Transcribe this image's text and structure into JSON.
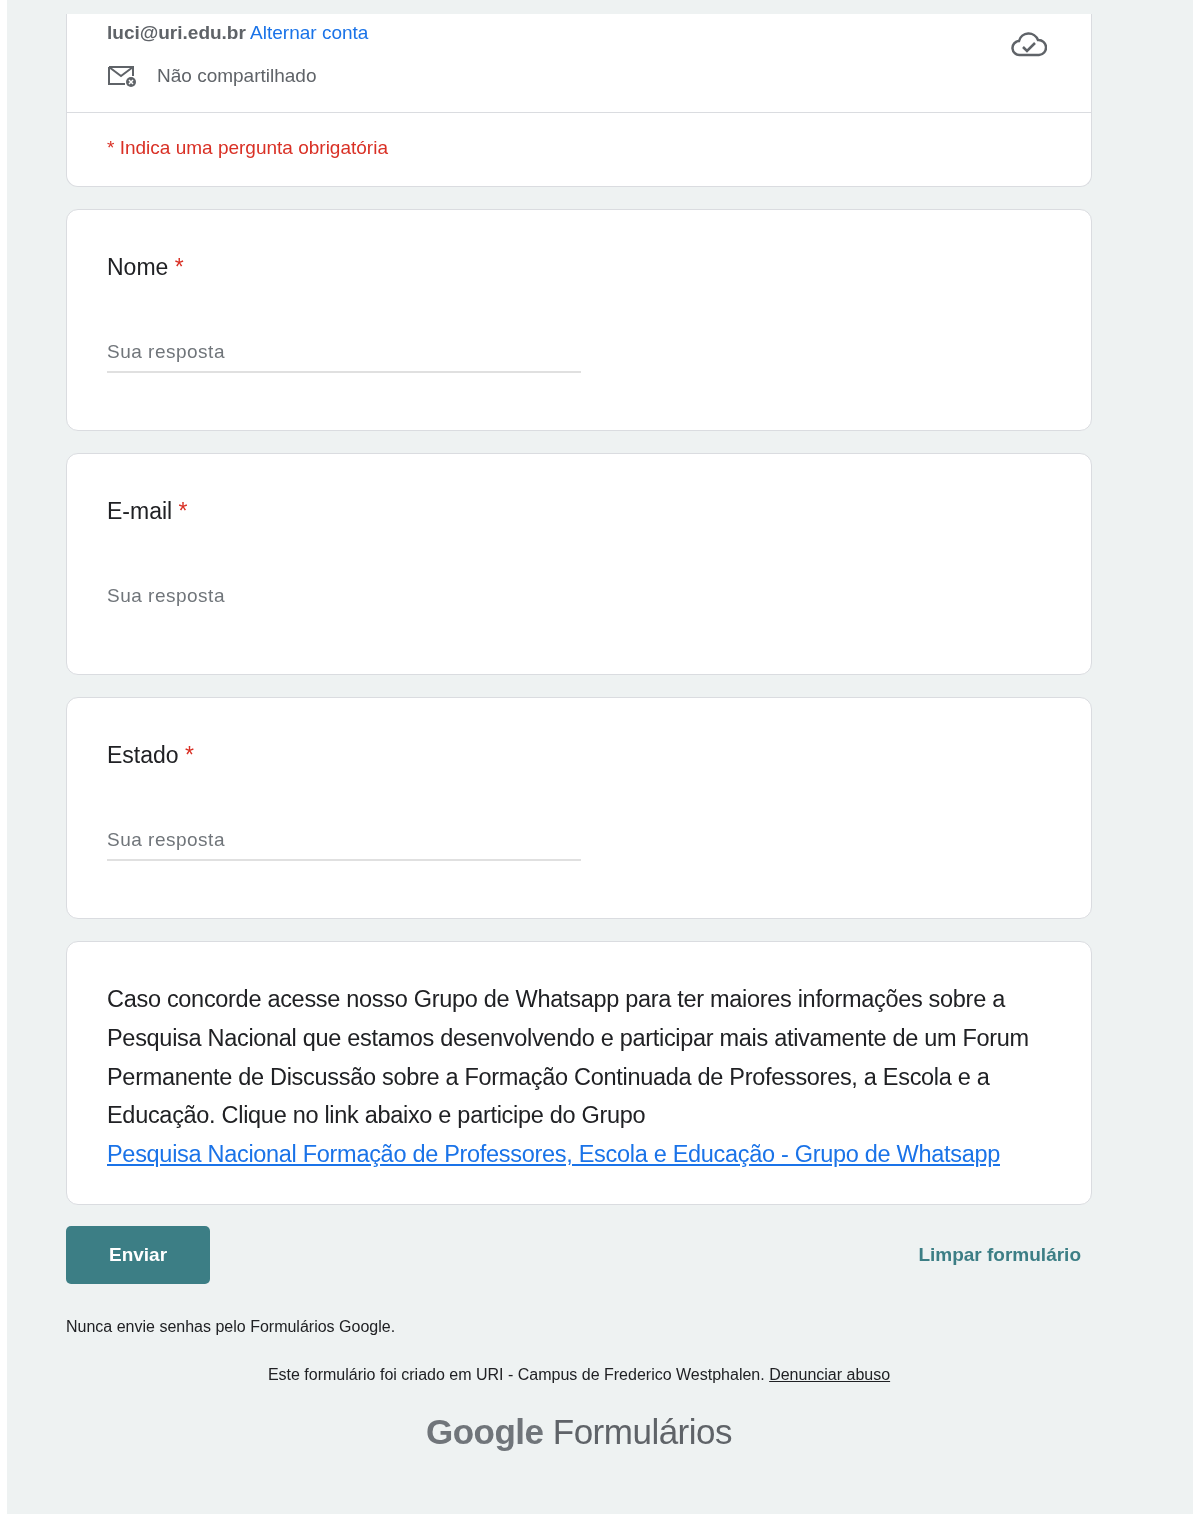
{
  "account": {
    "email": "luci@uri.edu.br",
    "switch_link": "Alternar conta",
    "sharing": "Não compartilhado"
  },
  "required_note": "* Indica uma pergunta obrigatória",
  "questions": [
    {
      "label": "Nome",
      "required_mark": "*",
      "placeholder": "Sua resposta",
      "underlined": true
    },
    {
      "label": "E-mail",
      "required_mark": "*",
      "placeholder": "Sua resposta",
      "underlined": false
    },
    {
      "label": "Estado",
      "required_mark": "*",
      "placeholder": "Sua resposta",
      "underlined": true
    }
  ],
  "info": {
    "text": "Caso concorde acesse  nosso Grupo de Whatsapp para ter maiores informações sobre a Pesquisa Nacional que estamos desenvolvendo e participar mais ativamente de um Forum Permanente de Discussão sobre a Formação Continuada de Professores, a Escola e a Educação. Clique no link abaixo e participe do Grupo",
    "link": "Pesquisa Nacional Formação de Professores, Escola e Educação - Grupo de Whatsapp"
  },
  "submit": "Enviar",
  "clear": "Limpar formulário",
  "footer": {
    "warning": "Nunca envie senhas pelo Formulários Google.",
    "created": "Este formulário foi criado em URI - Campus de Frederico Westphalen.",
    "report_link": "Denunciar abuso"
  },
  "brand": {
    "google": "Google",
    "product": "Formulários"
  }
}
